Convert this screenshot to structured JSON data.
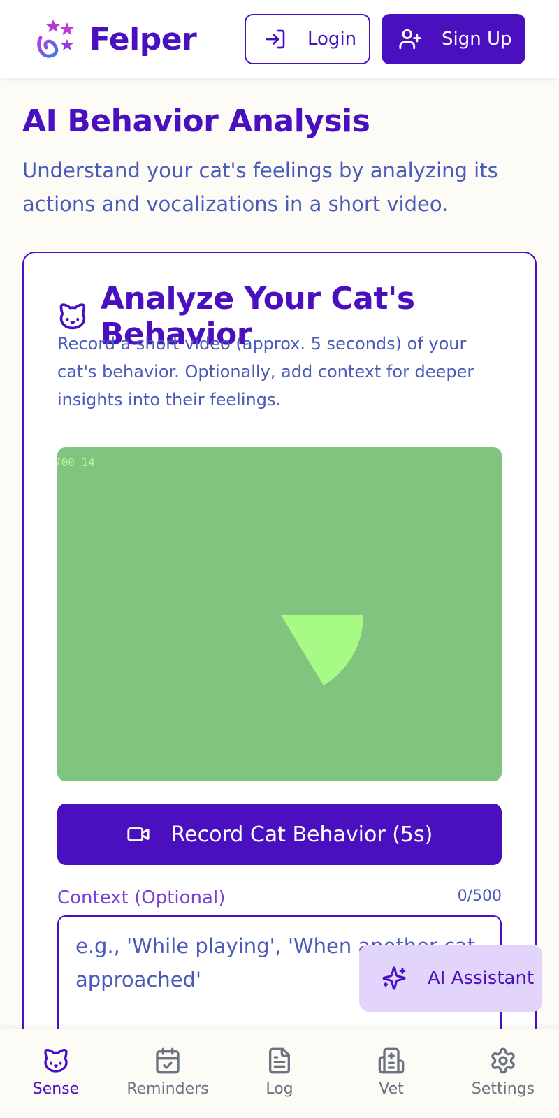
{
  "header": {
    "brand": "Felper",
    "login_label": "Login",
    "signup_label": "Sign Up"
  },
  "page": {
    "title": "AI Behavior Analysis",
    "subtitle": "Understand your cat's feelings by analyzing its actions and vocalizations in a short video."
  },
  "card": {
    "title": "Analyze Your Cat's Behavior",
    "description": "Record a short video (approx. 5 seconds) of your cat's behavior. Optionally, add context for deeper insights into their feelings.",
    "video_overlay": "700 14",
    "record_label": "Record Cat Behavior (5s)",
    "context_label": "Context (Optional)",
    "context_count": "0/500",
    "context_placeholder": "e.g., 'While playing', 'When another cat approached'",
    "context_value": ""
  },
  "assistant": {
    "label": "AI Assistant"
  },
  "nav": {
    "items": [
      {
        "label": "Sense",
        "icon": "cat-icon",
        "active": true
      },
      {
        "label": "Reminders",
        "icon": "calendar-check-icon",
        "active": false
      },
      {
        "label": "Log",
        "icon": "document-icon",
        "active": false
      },
      {
        "label": "Vet",
        "icon": "medical-clipboard-icon",
        "active": false
      },
      {
        "label": "Settings",
        "icon": "gear-icon",
        "active": false
      }
    ]
  },
  "colors": {
    "primary": "#4a10c0",
    "accent_text": "#4a5ab8",
    "video_bg": "#80c47f",
    "video_shape": "#a7fa86",
    "assistant_bg": "#e2d4fb",
    "page_bg": "#fdfbf6"
  }
}
